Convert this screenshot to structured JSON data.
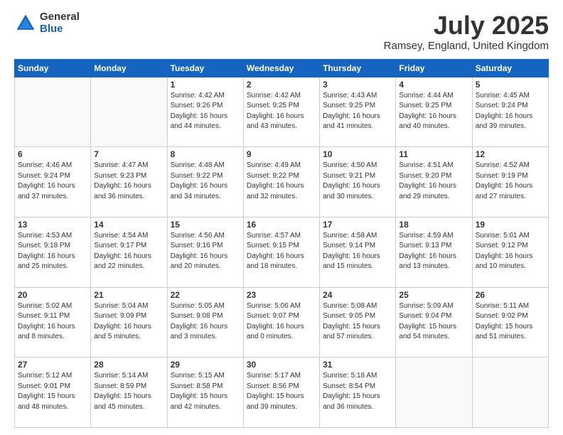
{
  "logo": {
    "general": "General",
    "blue": "Blue"
  },
  "title": "July 2025",
  "location": "Ramsey, England, United Kingdom",
  "headers": [
    "Sunday",
    "Monday",
    "Tuesday",
    "Wednesday",
    "Thursday",
    "Friday",
    "Saturday"
  ],
  "weeks": [
    [
      {
        "day": "",
        "info": ""
      },
      {
        "day": "",
        "info": ""
      },
      {
        "day": "1",
        "info": "Sunrise: 4:42 AM\nSunset: 9:26 PM\nDaylight: 16 hours\nand 44 minutes."
      },
      {
        "day": "2",
        "info": "Sunrise: 4:42 AM\nSunset: 9:25 PM\nDaylight: 16 hours\nand 43 minutes."
      },
      {
        "day": "3",
        "info": "Sunrise: 4:43 AM\nSunset: 9:25 PM\nDaylight: 16 hours\nand 41 minutes."
      },
      {
        "day": "4",
        "info": "Sunrise: 4:44 AM\nSunset: 9:25 PM\nDaylight: 16 hours\nand 40 minutes."
      },
      {
        "day": "5",
        "info": "Sunrise: 4:45 AM\nSunset: 9:24 PM\nDaylight: 16 hours\nand 39 minutes."
      }
    ],
    [
      {
        "day": "6",
        "info": "Sunrise: 4:46 AM\nSunset: 9:24 PM\nDaylight: 16 hours\nand 37 minutes."
      },
      {
        "day": "7",
        "info": "Sunrise: 4:47 AM\nSunset: 9:23 PM\nDaylight: 16 hours\nand 36 minutes."
      },
      {
        "day": "8",
        "info": "Sunrise: 4:48 AM\nSunset: 9:22 PM\nDaylight: 16 hours\nand 34 minutes."
      },
      {
        "day": "9",
        "info": "Sunrise: 4:49 AM\nSunset: 9:22 PM\nDaylight: 16 hours\nand 32 minutes."
      },
      {
        "day": "10",
        "info": "Sunrise: 4:50 AM\nSunset: 9:21 PM\nDaylight: 16 hours\nand 30 minutes."
      },
      {
        "day": "11",
        "info": "Sunrise: 4:51 AM\nSunset: 9:20 PM\nDaylight: 16 hours\nand 29 minutes."
      },
      {
        "day": "12",
        "info": "Sunrise: 4:52 AM\nSunset: 9:19 PM\nDaylight: 16 hours\nand 27 minutes."
      }
    ],
    [
      {
        "day": "13",
        "info": "Sunrise: 4:53 AM\nSunset: 9:18 PM\nDaylight: 16 hours\nand 25 minutes."
      },
      {
        "day": "14",
        "info": "Sunrise: 4:54 AM\nSunset: 9:17 PM\nDaylight: 16 hours\nand 22 minutes."
      },
      {
        "day": "15",
        "info": "Sunrise: 4:56 AM\nSunset: 9:16 PM\nDaylight: 16 hours\nand 20 minutes."
      },
      {
        "day": "16",
        "info": "Sunrise: 4:57 AM\nSunset: 9:15 PM\nDaylight: 16 hours\nand 18 minutes."
      },
      {
        "day": "17",
        "info": "Sunrise: 4:58 AM\nSunset: 9:14 PM\nDaylight: 16 hours\nand 15 minutes."
      },
      {
        "day": "18",
        "info": "Sunrise: 4:59 AM\nSunset: 9:13 PM\nDaylight: 16 hours\nand 13 minutes."
      },
      {
        "day": "19",
        "info": "Sunrise: 5:01 AM\nSunset: 9:12 PM\nDaylight: 16 hours\nand 10 minutes."
      }
    ],
    [
      {
        "day": "20",
        "info": "Sunrise: 5:02 AM\nSunset: 9:11 PM\nDaylight: 16 hours\nand 8 minutes."
      },
      {
        "day": "21",
        "info": "Sunrise: 5:04 AM\nSunset: 9:09 PM\nDaylight: 16 hours\nand 5 minutes."
      },
      {
        "day": "22",
        "info": "Sunrise: 5:05 AM\nSunset: 9:08 PM\nDaylight: 16 hours\nand 3 minutes."
      },
      {
        "day": "23",
        "info": "Sunrise: 5:06 AM\nSunset: 9:07 PM\nDaylight: 16 hours\nand 0 minutes."
      },
      {
        "day": "24",
        "info": "Sunrise: 5:08 AM\nSunset: 9:05 PM\nDaylight: 15 hours\nand 57 minutes."
      },
      {
        "day": "25",
        "info": "Sunrise: 5:09 AM\nSunset: 9:04 PM\nDaylight: 15 hours\nand 54 minutes."
      },
      {
        "day": "26",
        "info": "Sunrise: 5:11 AM\nSunset: 9:02 PM\nDaylight: 15 hours\nand 51 minutes."
      }
    ],
    [
      {
        "day": "27",
        "info": "Sunrise: 5:12 AM\nSunset: 9:01 PM\nDaylight: 15 hours\nand 48 minutes."
      },
      {
        "day": "28",
        "info": "Sunrise: 5:14 AM\nSunset: 8:59 PM\nDaylight: 15 hours\nand 45 minutes."
      },
      {
        "day": "29",
        "info": "Sunrise: 5:15 AM\nSunset: 8:58 PM\nDaylight: 15 hours\nand 42 minutes."
      },
      {
        "day": "30",
        "info": "Sunrise: 5:17 AM\nSunset: 8:56 PM\nDaylight: 15 hours\nand 39 minutes."
      },
      {
        "day": "31",
        "info": "Sunrise: 5:18 AM\nSunset: 8:54 PM\nDaylight: 15 hours\nand 36 minutes."
      },
      {
        "day": "",
        "info": ""
      },
      {
        "day": "",
        "info": ""
      }
    ]
  ]
}
